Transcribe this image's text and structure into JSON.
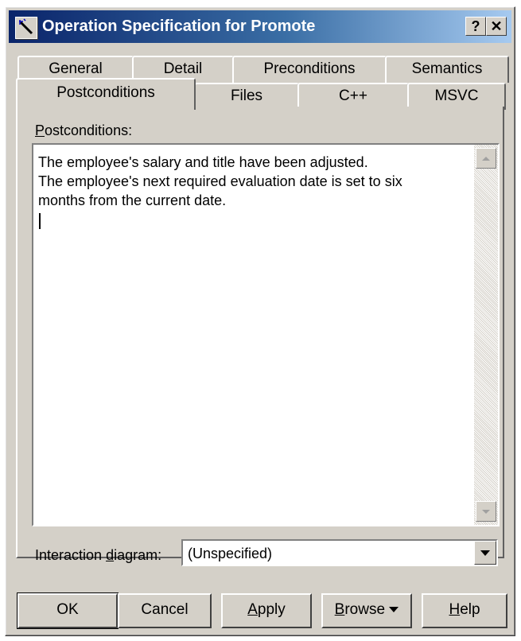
{
  "window": {
    "title": "Operation Specification for Promote",
    "help_button": "?",
    "close_button": "✕"
  },
  "tabs": {
    "back_row": [
      "General",
      "Detail",
      "Preconditions",
      "Semantics"
    ],
    "front_row": [
      "Postconditions",
      "Files",
      "C++",
      "MSVC"
    ],
    "active": "Postconditions"
  },
  "postconditions": {
    "label_mnemonic": "P",
    "label_rest": "ostconditions:",
    "lines": [
      "The employee's salary and title have been adjusted.",
      "The employee's next required evaluation date is set to six",
      "months from the current date."
    ]
  },
  "interaction_diagram": {
    "label_before": "Interaction ",
    "label_mnemonic": "d",
    "label_after": "iagram:",
    "value": "(Unspecified)"
  },
  "buttons": {
    "ok": "OK",
    "cancel": "Cancel",
    "apply_mnemonic": "A",
    "apply_rest": "pply",
    "browse_mnemonic": "B",
    "browse_rest": "rowse",
    "help_mnemonic": "H",
    "help_rest": "elp"
  }
}
